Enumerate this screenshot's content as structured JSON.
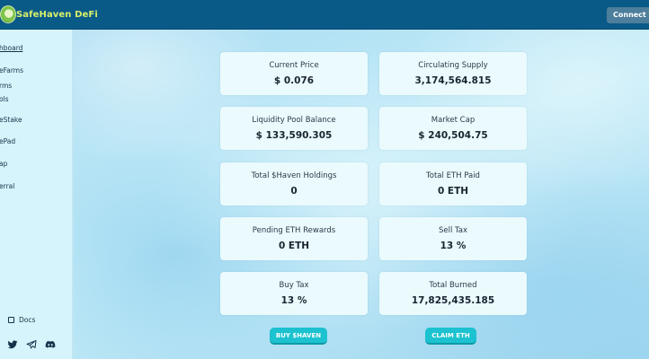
{
  "header": {
    "brand": "SafeHaven DeFi",
    "connect_label": "Connect W"
  },
  "sidebar": {
    "items": [
      {
        "label": "hboard",
        "active": true
      },
      {
        "label": "eFarms"
      },
      {
        "label": "rms"
      },
      {
        "label": "ols"
      },
      {
        "label": "eStake"
      },
      {
        "label": "ePad"
      },
      {
        "label": "ap"
      },
      {
        "label": "erral"
      }
    ],
    "docs_label": "Docs",
    "social_icons": [
      "twitter-icon",
      "telegram-icon",
      "discord-icon"
    ]
  },
  "stats": [
    {
      "label": "Current Price",
      "value": "$ 0.076"
    },
    {
      "label": "Circulating Supply",
      "value": "3,174,564.815"
    },
    {
      "label": "Liquidity Pool Balance",
      "value": "$ 133,590.305"
    },
    {
      "label": "Market Cap",
      "value": "$ 240,504.75"
    },
    {
      "label": "Total $Haven Holdings",
      "value": "0"
    },
    {
      "label": "Total ETH Paid",
      "value": "0 ETH"
    },
    {
      "label": "Pending ETH Rewards",
      "value": "0 ETH"
    },
    {
      "label": "Sell Tax",
      "value": "13 %"
    },
    {
      "label": "Buy Tax",
      "value": "13 %"
    },
    {
      "label": "Total Burned",
      "value": "17,825,435.185"
    }
  ],
  "actions": {
    "buy_label": "BUY $HAVEN",
    "claim_label": "CLAIM ETH"
  },
  "colors": {
    "header_bg": "#0a5a88",
    "brand_text": "#d8f06a",
    "sidebar_bg": "#d6f4fb",
    "card_bg": "#eafafd",
    "button_bg": "#1cc2cf"
  }
}
